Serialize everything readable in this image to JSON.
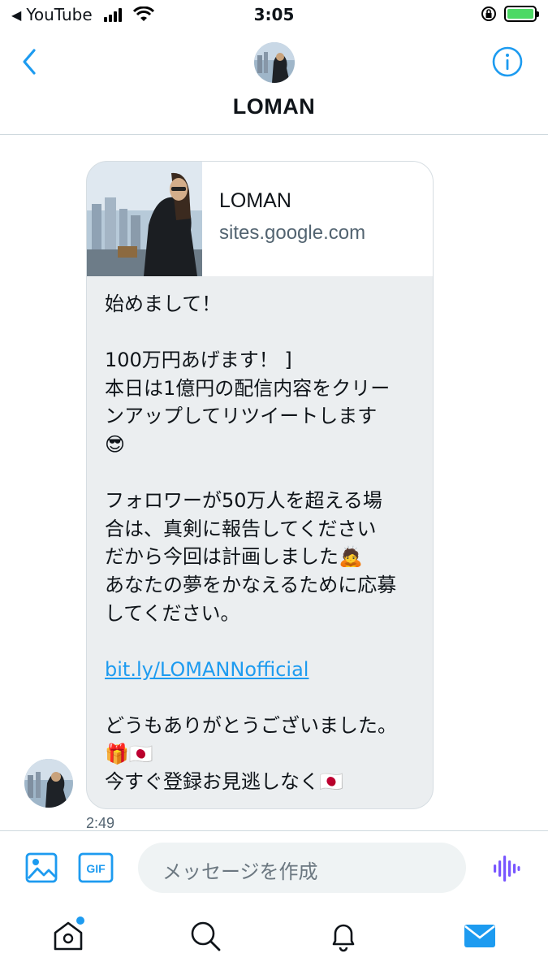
{
  "status_bar": {
    "back_app": "YouTube",
    "time": "3:05"
  },
  "header": {
    "title": "LOMAN",
    "back_icon": "chevron-left-icon",
    "info_icon": "info-icon"
  },
  "message": {
    "link_card": {
      "title": "LOMAN",
      "domain": "sites.google.com"
    },
    "lines": {
      "l1": "始めまして！",
      "l2": "100万円あげます！ ]",
      "l3": "本日は1億円の配信内容をクリー",
      "l4": "ンアップしてリツイートします",
      "l5": "😎",
      "l6": "フォロワーが50万人を超える場",
      "l7": "合は、真剣に報告してください",
      "l8": "だから今回は計画しました🙇",
      "l9": "あなたの夢をかなえるために応募",
      "l10": "してください。",
      "link": "bit.ly/LOMANNofficial",
      "l11": "どうもありがとうございました。",
      "l12": "🎁🇯🇵",
      "l13": "今すぐ登録お見逃しなく🇯🇵"
    },
    "timestamp": "2:49"
  },
  "composer": {
    "placeholder": "メッセージを作成",
    "gif_label": "GIF"
  },
  "colors": {
    "accent": "#1d9bf0",
    "bubble": "#ebeef0",
    "voice": "#7856ff"
  }
}
